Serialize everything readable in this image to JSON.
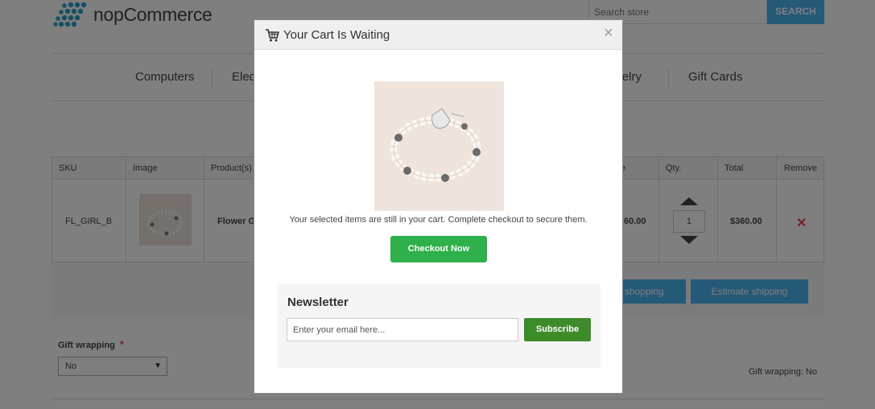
{
  "header": {
    "logo_text_prefix": "nop",
    "logo_text_suffix": "Commerce",
    "search_placeholder": "Search store",
    "search_button": "SEARCH"
  },
  "menu": {
    "items": [
      "Computers",
      "Elec",
      "welry",
      "Gift Cards"
    ]
  },
  "cart": {
    "columns": [
      "SKU",
      "Image",
      "Product(s)",
      "e",
      "Qty.",
      "Total",
      "Remove"
    ],
    "row": {
      "sku": "FL_GIRL_B",
      "product": "Flower G",
      "price": "60.00",
      "qty": "1",
      "total": "$360.00",
      "remove": "✕"
    },
    "actions": {
      "continue_label": "e shopping",
      "estimate_label": "Estimate shipping"
    }
  },
  "gift": {
    "label": "Gift wrapping",
    "required_mark": "*",
    "selected": "No",
    "summary": "Gift wrapping: No"
  },
  "modal": {
    "title": "Your Cart Is Waiting",
    "close": "×",
    "message": "Your selected items are still in your cart. Complete checkout to secure them.",
    "checkout_button": "Checkout Now",
    "newsletter": {
      "title": "Newsletter",
      "placeholder": "Enter your email here...",
      "subscribe_button": "Subscribe"
    }
  },
  "colors": {
    "accent_blue": "#4ab2f1",
    "checkout_green": "#2eb04b",
    "subscribe_green": "#3e8b2a",
    "remove_red": "#e4434b"
  }
}
